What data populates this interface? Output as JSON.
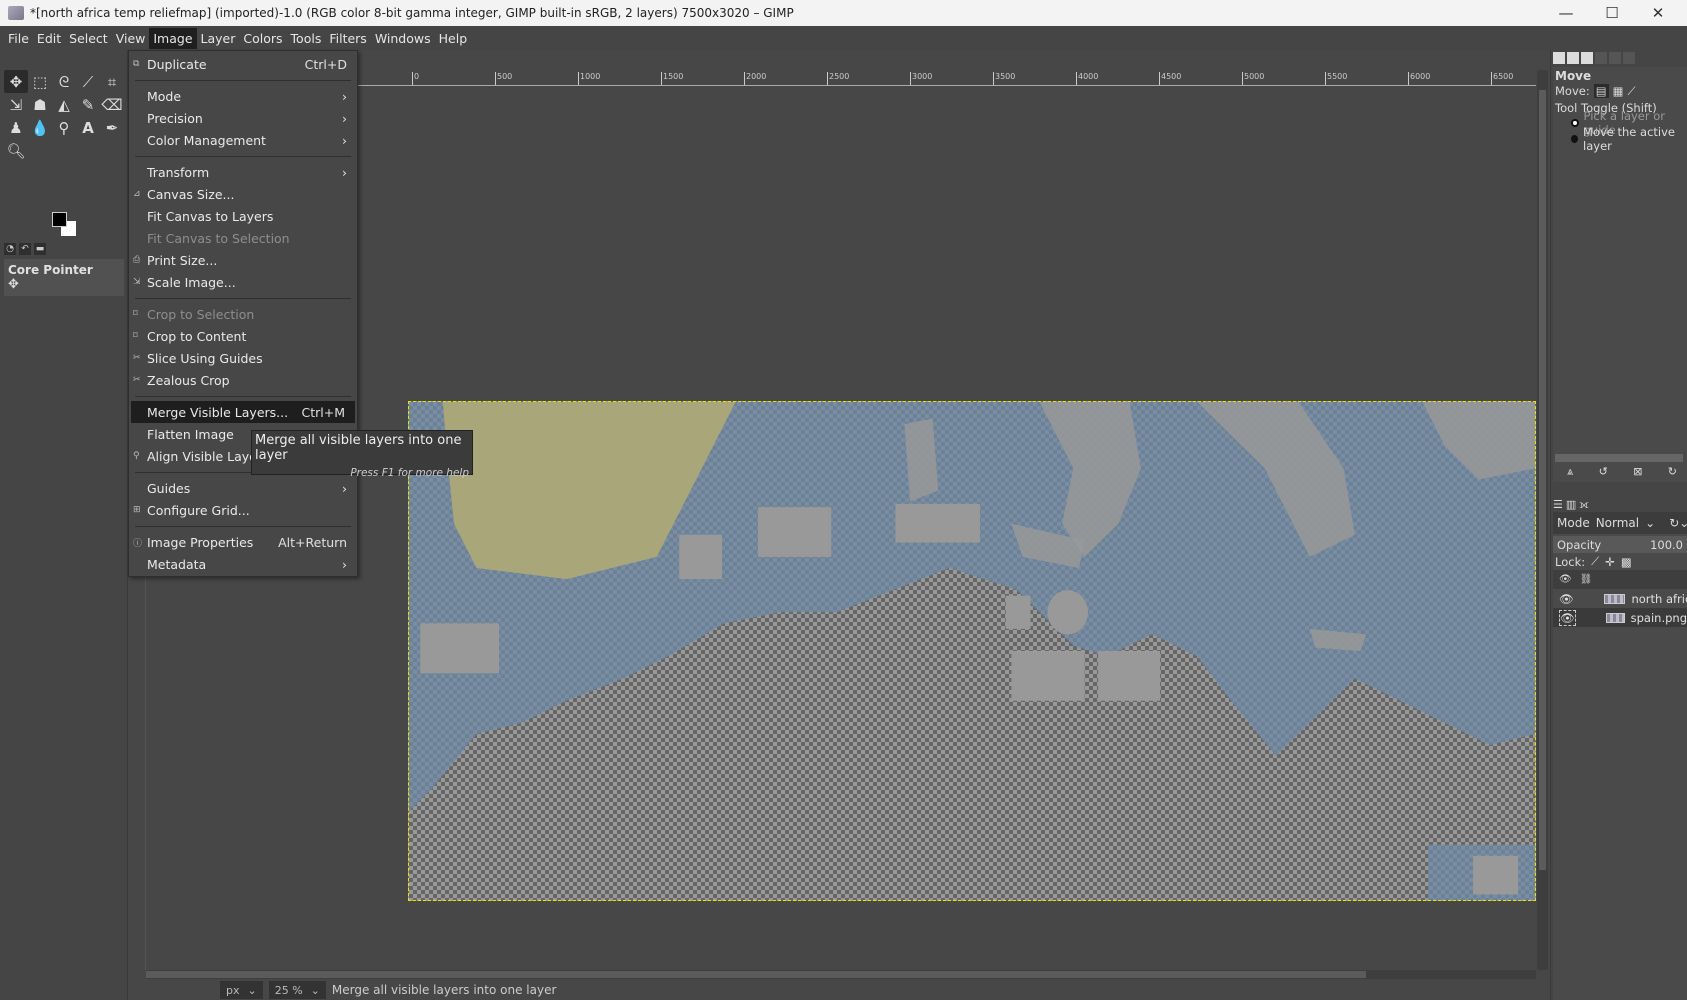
{
  "window": {
    "title": "*[north africa temp reliefmap] (imported)-1.0 (RGB color 8-bit gamma integer, GIMP built-in sRGB, 2 layers) 7500x3020 – GIMP",
    "minimize": "—",
    "maximize": "☐",
    "close": "✕"
  },
  "menubar": [
    "File",
    "Edit",
    "Select",
    "View",
    "Image",
    "Layer",
    "Colors",
    "Tools",
    "Filters",
    "Windows",
    "Help"
  ],
  "image_menu": {
    "items": [
      {
        "label": "Duplicate",
        "shortcut": "Ctrl+D",
        "icon": "duplicate-icon"
      },
      {
        "sep": true
      },
      {
        "label": "Mode",
        "submenu": true
      },
      {
        "label": "Precision",
        "submenu": true
      },
      {
        "label": "Color Management",
        "submenu": true
      },
      {
        "sep": true
      },
      {
        "label": "Transform",
        "submenu": true
      },
      {
        "label": "Canvas Size...",
        "icon": "canvas-size-icon"
      },
      {
        "label": "Fit Canvas to Layers"
      },
      {
        "label": "Fit Canvas to Selection",
        "disabled": true
      },
      {
        "label": "Print Size...",
        "icon": "print-icon"
      },
      {
        "label": "Scale Image...",
        "icon": "scale-icon"
      },
      {
        "sep": true
      },
      {
        "label": "Crop to Selection",
        "disabled": true,
        "icon": "crop-icon"
      },
      {
        "label": "Crop to Content",
        "icon": "crop-icon"
      },
      {
        "label": "Slice Using Guides",
        "icon": "slice-icon"
      },
      {
        "label": "Zealous Crop",
        "icon": "zealous-icon"
      },
      {
        "sep": true
      },
      {
        "label": "Merge Visible Layers...",
        "shortcut": "Ctrl+M",
        "highlighted": true
      },
      {
        "label": "Flatten Image"
      },
      {
        "label": "Align Visible Layers...",
        "icon": "align-icon"
      },
      {
        "sep": true
      },
      {
        "label": "Guides",
        "submenu": true
      },
      {
        "label": "Configure Grid...",
        "icon": "grid-icon"
      },
      {
        "sep": true
      },
      {
        "label": "Image Properties",
        "shortcut": "Alt+Return",
        "icon": "info-icon"
      },
      {
        "label": "Metadata",
        "submenu": true
      }
    ]
  },
  "tooltip": {
    "text": "Merge all visible layers into one layer",
    "help": "Press F1 for more help"
  },
  "toolbox": {
    "device_status": "Core Pointer"
  },
  "ruler_labels": [
    "0",
    "500",
    "1000",
    "1500",
    "2000",
    "2500",
    "3000",
    "3500",
    "4000",
    "4500",
    "5000",
    "5500",
    "6000",
    "6500"
  ],
  "statusbar": {
    "unit": "px",
    "zoom": "25 %",
    "message": "Merge all visible layers into one layer"
  },
  "tool_options": {
    "title": "Move",
    "move_label": "Move:",
    "toggle_label": "Tool Toggle  (Shift)",
    "options": [
      {
        "label": "Pick a layer or guide",
        "selected": true
      },
      {
        "label": "Move the active layer",
        "selected": false
      }
    ]
  },
  "layers": {
    "mode_label": "Mode",
    "mode": "Normal",
    "opacity_label": "Opacity",
    "opacity": "100.0",
    "lock_label": "Lock:",
    "items": [
      {
        "name": "north africa temp reliefmap",
        "visible": true
      },
      {
        "name": "spain.png",
        "visible": true,
        "active": true
      }
    ]
  },
  "colors": {
    "sea": "#6f8ba6",
    "land_spain": "#a9a77a",
    "canvas_bg": "#474747",
    "highlight": "#1e1e1e"
  }
}
